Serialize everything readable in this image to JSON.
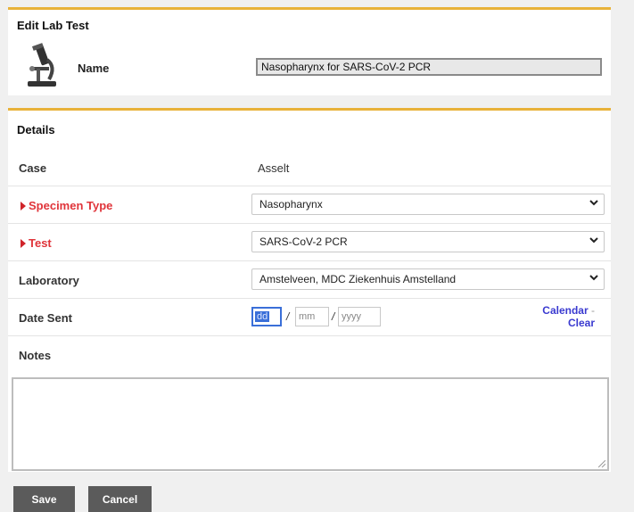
{
  "header": {
    "title": "Edit Lab Test",
    "icon": "microscope-icon",
    "name_label": "Name",
    "name_value": "Nasopharynx for SARS-CoV-2 PCR"
  },
  "details": {
    "title": "Details",
    "case_label": "Case",
    "case_value": "Asselt",
    "specimen_label": "Specimen Type",
    "specimen_value": "Nasopharynx",
    "test_label": "Test",
    "test_value": "SARS-CoV-2 PCR",
    "lab_label": "Laboratory",
    "lab_value": "Amstelveen, MDC Ziekenhuis Amstelland",
    "date_label": "Date Sent",
    "date_dd": "dd",
    "date_mm": "mm",
    "date_yyyy": "yyyy",
    "date_slash1": "/",
    "date_slash2": "/",
    "calendar_link": "Calendar",
    "clear_link": "Clear",
    "notes_label": "Notes",
    "notes_value": ""
  },
  "buttons": {
    "save": "Save",
    "cancel": "Cancel"
  },
  "colors": {
    "accent": "#e8b23a",
    "required": "#e0343a",
    "link": "#3a3ad0",
    "button": "#5b5b5b"
  }
}
